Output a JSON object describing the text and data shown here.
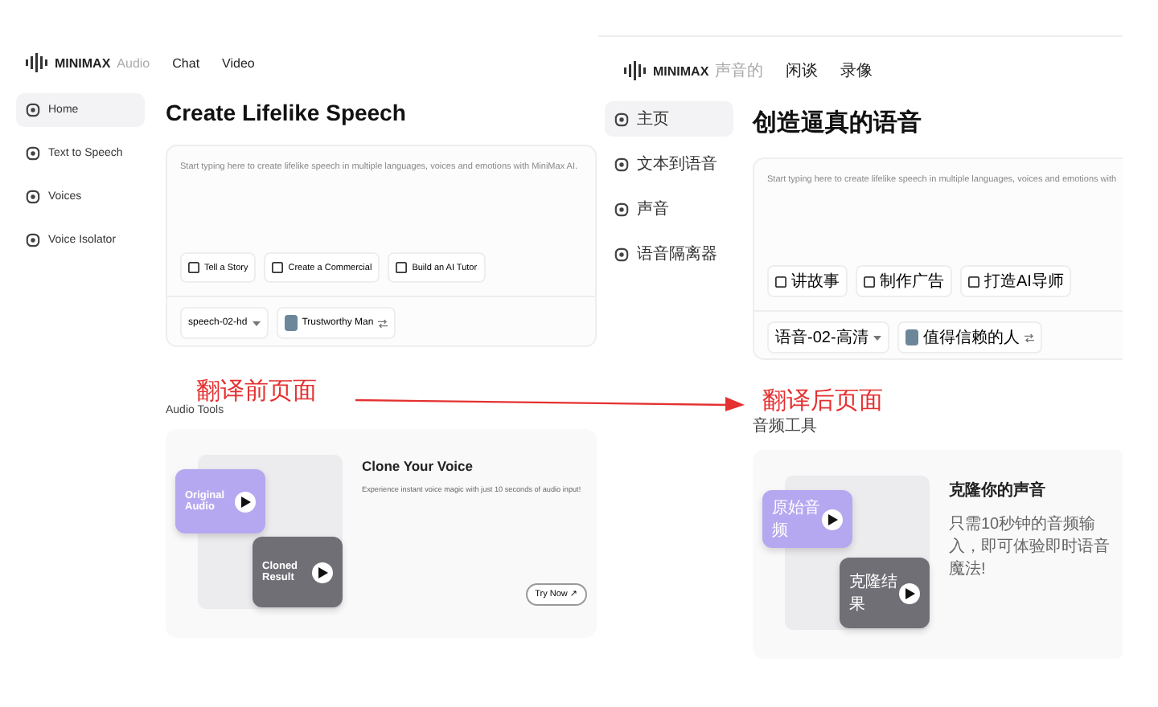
{
  "panels": [
    {
      "header": {
        "brand": "MINIMAX",
        "product": "Audio",
        "nav": [
          "Chat",
          "Video"
        ]
      },
      "sidebar": [
        {
          "label": "Home",
          "selected": true
        },
        {
          "label": "Text to Speech",
          "selected": false
        },
        {
          "label": "Voices",
          "selected": false
        },
        {
          "label": "Voice Isolator",
          "selected": false
        }
      ],
      "title": "Create Lifelike Speech",
      "editor": {
        "placeholder": "Start typing here to create lifelike speech in multiple languages, voices and emotions with MiniMax AI.",
        "chips": [
          "Tell a Story",
          "Create a Commercial",
          "Build an AI Tutor"
        ],
        "model": "speech-02-hd",
        "voice": "Trustworthy Man"
      },
      "section_title": "Audio Tools",
      "card": {
        "original": "Original Audio",
        "cloned": "Cloned Result",
        "title": "Clone Your Voice",
        "description": "Experience instant voice magic with just 10 seconds of audio input!",
        "button": "Try Now ↗"
      }
    },
    {
      "header": {
        "brand": "MINIMAX",
        "product": "声音的",
        "nav": [
          "闲谈",
          "录像"
        ]
      },
      "sidebar": [
        {
          "label": "主页",
          "selected": true
        },
        {
          "label": "文本到语音",
          "selected": false
        },
        {
          "label": "声音",
          "selected": false
        },
        {
          "label": "语音隔离器",
          "selected": false
        }
      ],
      "title": "创造逼真的语音",
      "editor": {
        "placeholder": "Start typing here to create lifelike speech in multiple languages, voices and emotions with",
        "chips": [
          "讲故事",
          "制作广告",
          "打造AI导师"
        ],
        "model": "语音-02-高清",
        "voice": "值得信赖的人"
      },
      "section_title": "音频工具",
      "card": {
        "original": "原始音频",
        "cloned": "克隆结果",
        "title": "克隆你的声音",
        "description": "只需10秒钟的音频输入，即可体验即时语音魔法!"
      }
    }
  ],
  "annotations": [
    "翻译前页面",
    "翻译后页面"
  ]
}
